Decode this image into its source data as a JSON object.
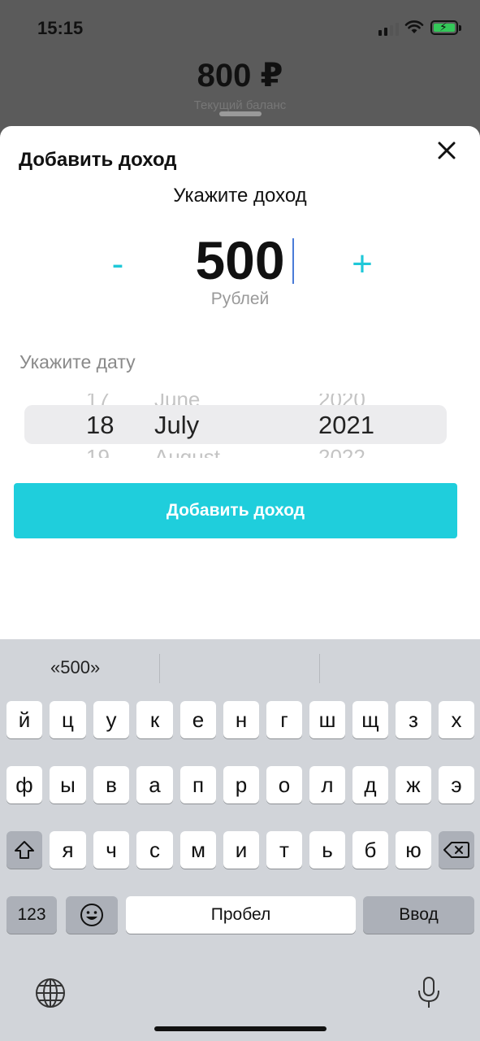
{
  "status_bar": {
    "time": "15:15"
  },
  "background": {
    "balance_amount": "800 ₽",
    "balance_label": "Текущий баланс"
  },
  "sheet": {
    "title": "Добавить доход",
    "prompt": "Укажите доход",
    "amount": "500",
    "currency": "Рублей",
    "date_label": "Укажите дату",
    "picker": {
      "day": {
        "prev": "17",
        "selected": "18",
        "next": "19"
      },
      "month": {
        "prev": "June",
        "selected": "July",
        "next": "August"
      },
      "year": {
        "prev": "2020",
        "selected": "2021",
        "next": "2022"
      }
    },
    "minus_label": "-",
    "plus_label": "+",
    "submit_label": "Добавить доход"
  },
  "keyboard": {
    "suggestions": [
      "«500»",
      "",
      ""
    ],
    "row1": [
      "й",
      "ц",
      "у",
      "к",
      "е",
      "н",
      "г",
      "ш",
      "щ",
      "з",
      "х"
    ],
    "row2": [
      "ф",
      "ы",
      "в",
      "а",
      "п",
      "р",
      "о",
      "л",
      "д",
      "ж",
      "э"
    ],
    "row3": [
      "я",
      "ч",
      "с",
      "м",
      "и",
      "т",
      "ь",
      "б",
      "ю"
    ],
    "numbers_label": "123",
    "space_label": "Пробел",
    "return_label": "Ввод",
    "icons": [
      "shift-icon",
      "backspace-icon",
      "emoji-icon",
      "globe-icon",
      "microphone-icon"
    ]
  },
  "colors": {
    "accent": "#1fcedc",
    "sheet": "#ffffff",
    "keyboard": "#d1d4d9"
  }
}
